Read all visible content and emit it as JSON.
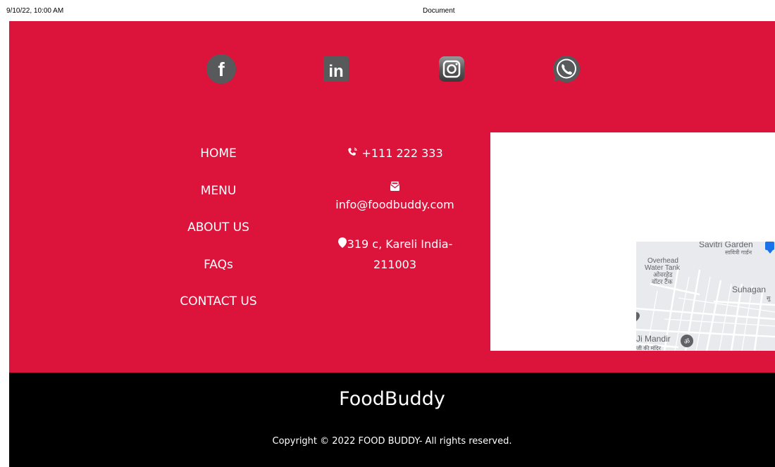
{
  "print_header": {
    "datetime": "9/10/22, 10:00 AM",
    "title": "Document"
  },
  "social": [
    {
      "name": "facebook",
      "icon": "facebook-icon",
      "glyph": "f"
    },
    {
      "name": "linkedin",
      "icon": "linkedin-icon",
      "glyph": "in"
    },
    {
      "name": "instagram",
      "icon": "instagram-icon"
    },
    {
      "name": "whatsapp",
      "icon": "whatsapp-icon"
    }
  ],
  "nav": {
    "home": "HOME",
    "menu": "MENU",
    "about": "ABOUT US",
    "faqs": "FAQs",
    "contact": "CONTACT US"
  },
  "contact": {
    "phone": "+111 222 333",
    "phone_icon": "phone-icon",
    "email": "info@foodbuddy.com",
    "email_icon": "mail-icon",
    "address": "319 c, Kareli India-211003",
    "address_icon": "map-pin-icon"
  },
  "map": {
    "labels": {
      "savitri_garden": "Savitri Garden",
      "savitri_garden_hi": "सावित्री गार्डन",
      "overhead_tank": "Overhead",
      "water_tank": "Water Tank",
      "overhead_hi": "ओवरहेड",
      "water_tank_hi": "वॉटर टैंक",
      "suhagan": "Suhagan",
      "suhagan_hi": "सु",
      "ji_mandir": "Ji Mandir",
      "ji_mandir_hi": "जी की मंदिर"
    }
  },
  "footer": {
    "brand": "FoodBuddy",
    "copyright": "Copyright © 2022 FOOD BUDDY- All rights reserved."
  },
  "colors": {
    "footer_red": "#dc143c",
    "footer_black": "#000000",
    "icon_gray": "#58595b",
    "map_bg": "#e8eaed"
  }
}
